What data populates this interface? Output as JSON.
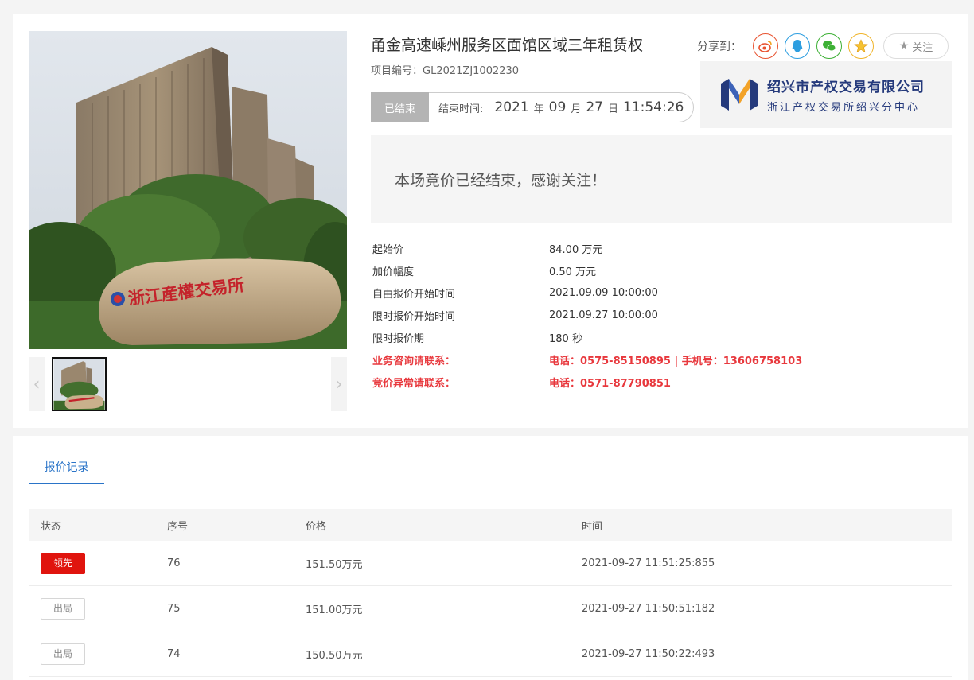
{
  "project": {
    "title": "甬金高速嵊州服务区面馆区域三年租赁权",
    "number_label": "项目编号：",
    "number": "GL2021ZJ1002230"
  },
  "share": {
    "label": "分享到：",
    "buttons": [
      {
        "name": "weibo-icon",
        "color": "#e8522f"
      },
      {
        "name": "qq-icon",
        "color": "#2d9ee0"
      },
      {
        "name": "wechat-icon",
        "color": "#3db035"
      },
      {
        "name": "qzone-icon",
        "color": "#f0b42a"
      }
    ],
    "follow_label": "关注"
  },
  "timer": {
    "status": "已结束",
    "label": "结束时间:",
    "year": "2021",
    "year_unit": "年",
    "month": "09",
    "month_unit": "月",
    "day": "27",
    "day_unit": "日",
    "time": "11:54:26"
  },
  "org": {
    "name": "绍兴市产权交易有限公司",
    "sub": "浙江产权交易所绍兴分中心"
  },
  "photo": {
    "stone_text": "浙江産權交易所"
  },
  "notice": "本场竞价已经结束，感谢关注！",
  "info": [
    {
      "label": "起始价",
      "value": "84.00 万元",
      "highlight": false
    },
    {
      "label": "加价幅度",
      "value": "0.50 万元",
      "highlight": false
    },
    {
      "label": "自由报价开始时间",
      "value": "2021.09.09 10:00:00",
      "highlight": false
    },
    {
      "label": "限时报价开始时间",
      "value": "2021.09.27 10:00:00",
      "highlight": false
    },
    {
      "label": "限时报价期",
      "value": "180 秒",
      "highlight": false
    },
    {
      "label": "业务咨询请联系：",
      "value": "电话：0575-85150895 | 手机号：13606758103",
      "highlight": true
    },
    {
      "label": "竞价异常请联系：",
      "value": "电话：0571-87790851",
      "highlight": true
    }
  ],
  "tabs": {
    "active": "报价记录"
  },
  "table": {
    "headers": [
      "状态",
      "序号",
      "价格",
      "时间"
    ],
    "rows": [
      {
        "status": "领先",
        "lead": true,
        "seq": "76",
        "price": "151.50万元",
        "time": "2021-09-27 11:51:25:855"
      },
      {
        "status": "出局",
        "lead": false,
        "seq": "75",
        "price": "151.00万元",
        "time": "2021-09-27 11:50:51:182"
      },
      {
        "status": "出局",
        "lead": false,
        "seq": "74",
        "price": "150.50万元",
        "time": "2021-09-27 11:50:22:493"
      }
    ]
  }
}
